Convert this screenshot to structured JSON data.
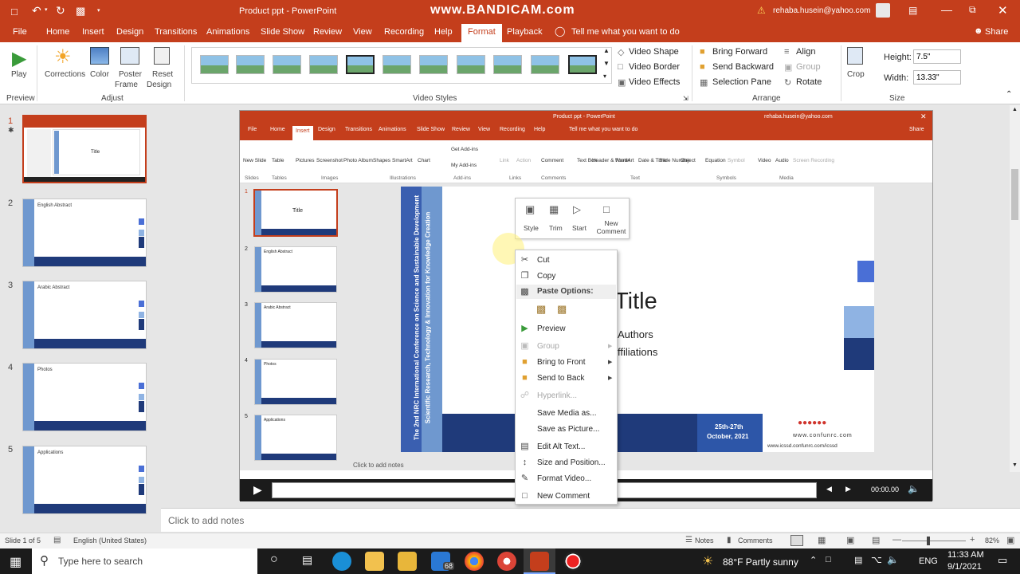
{
  "window": {
    "title": "Product ppt  -  PowerPoint",
    "watermark": "www.BANDICAM.com",
    "user": "rehaba.husein@yahoo.com"
  },
  "tabs": [
    "File",
    "Home",
    "Insert",
    "Design",
    "Transitions",
    "Animations",
    "Slide Show",
    "Review",
    "View",
    "Recording",
    "Help",
    "Format",
    "Playback"
  ],
  "tell_me": "Tell me what you want to do",
  "share": "Share",
  "ribbon": {
    "preview": {
      "play": "Play",
      "group": "Preview"
    },
    "adjust": {
      "corrections": "Corrections",
      "color": "Color",
      "poster1": "Poster",
      "poster2": "Frame",
      "reset1": "Reset",
      "reset2": "Design",
      "group": "Adjust"
    },
    "video_styles": {
      "group": "Video Styles",
      "shape": "Video Shape",
      "border": "Video Border",
      "effects": "Video Effects"
    },
    "arrange": {
      "bring_forward": "Bring Forward",
      "send_backward": "Send Backward",
      "selection_pane": "Selection Pane",
      "align": "Align",
      "group_btn": "Group",
      "rotate": "Rotate",
      "group": "Arrange"
    },
    "size": {
      "crop": "Crop",
      "height_label": "Height:",
      "height": "7.5\"",
      "width_label": "Width:",
      "width": "13.33\"",
      "group": "Size"
    }
  },
  "slides": [
    {
      "num": "1",
      "title": "Title"
    },
    {
      "num": "2",
      "title": "English Abstract"
    },
    {
      "num": "3",
      "title": "Arabic Abstract"
    },
    {
      "num": "4",
      "title": "Photos"
    },
    {
      "num": "5",
      "title": "Applications"
    }
  ],
  "inner": {
    "title": "Product ppt  -  PowerPoint",
    "user": "rehaba.husein@yahoo.com",
    "tabs": [
      "File",
      "Home",
      "Insert",
      "Design",
      "Transitions",
      "Animations",
      "Slide Show",
      "Review",
      "View",
      "Recording",
      "Help"
    ],
    "tell_me": "Tell me what you want to do",
    "share": "Share",
    "ribbon": [
      "New Slide",
      "Table",
      "Pictures",
      "Screenshot",
      "Photo Album",
      "Shapes",
      "SmartArt",
      "Chart",
      "Get Add-ins",
      "My Add-ins",
      "Link",
      "Action",
      "Comment",
      "Text Box",
      "Header & Footer",
      "WordArt",
      "Date & Time",
      "Slide Number",
      "Object",
      "Equation",
      "Symbol",
      "Video",
      "Audio",
      "Screen Recording"
    ],
    "groups": [
      "Slides",
      "Tables",
      "Images",
      "Illustrations",
      "Add-ins",
      "Links",
      "Comments",
      "Text",
      "Symbols",
      "Media"
    ],
    "slide_title": "Title",
    "slide_authors": "Authors",
    "slide_affil": "ffiliations",
    "banner": "The 2nd NRC International Conference on Science and Sustainable Development",
    "banner2": "Scientific Research, Technology & Innovation for Knowledge Creation",
    "date1": "25th-27th",
    "date2": "October, 2021",
    "site1": "www.confunrc.com",
    "site2": "www.icssd.confunrc.com/icssd",
    "notes": "Click to add notes",
    "time": "00:00.00",
    "thumbs": [
      "1",
      "2",
      "3",
      "4",
      "5"
    ],
    "thumb_titles": [
      "Title",
      "English Abstract",
      "Arabic Abstract",
      "Photos",
      "Applications"
    ]
  },
  "minibar": [
    "Style",
    "Trim",
    "Start",
    "New Comment"
  ],
  "context_menu": [
    {
      "label": "Cut",
      "disabled": false
    },
    {
      "label": "Copy",
      "disabled": false
    },
    {
      "label": "Paste Options:",
      "disabled": false
    },
    {
      "label": "Preview",
      "disabled": false
    },
    {
      "label": "Group",
      "disabled": true
    },
    {
      "label": "Bring to Front",
      "disabled": false
    },
    {
      "label": "Send to Back",
      "disabled": false
    },
    {
      "label": "Hyperlink...",
      "disabled": true
    },
    {
      "label": "Save Media as...",
      "disabled": false
    },
    {
      "label": "Save as Picture...",
      "disabled": false
    },
    {
      "label": "Edit Alt Text...",
      "disabled": false
    },
    {
      "label": "Size and Position...",
      "disabled": false
    },
    {
      "label": "Format Video...",
      "disabled": false
    },
    {
      "label": "New Comment",
      "disabled": false
    }
  ],
  "notes_placeholder": "Click to add notes",
  "status": {
    "slide": "Slide 1 of 5",
    "language": "English (United States)",
    "notes": "Notes",
    "comments": "Comments",
    "zoom": "82%"
  },
  "taskbar": {
    "search": "Type here to search",
    "weather": "88°F  Partly sunny",
    "lang": "ENG",
    "time": "11:33 AM",
    "date": "9/1/2021",
    "mail_badge": "68"
  }
}
